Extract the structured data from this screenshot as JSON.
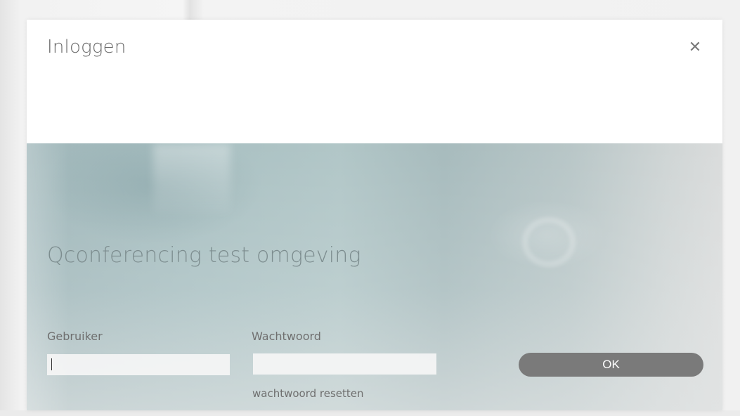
{
  "dialog": {
    "title": "Inloggen",
    "close_icon": "close-icon",
    "close_glyph": "✕"
  },
  "body": {
    "subtitle": "Qconferencing test omgeving",
    "user_label": "Gebruiker",
    "user_value": "",
    "password_label": "Wachtwoord",
    "password_value": "",
    "reset_link": "wachtwoord resetten",
    "ok_label": "OK"
  },
  "colors": {
    "button": "#7a7a7a",
    "title_text": "#6a6a6a",
    "subtitle_text": "#7d8d8f"
  }
}
